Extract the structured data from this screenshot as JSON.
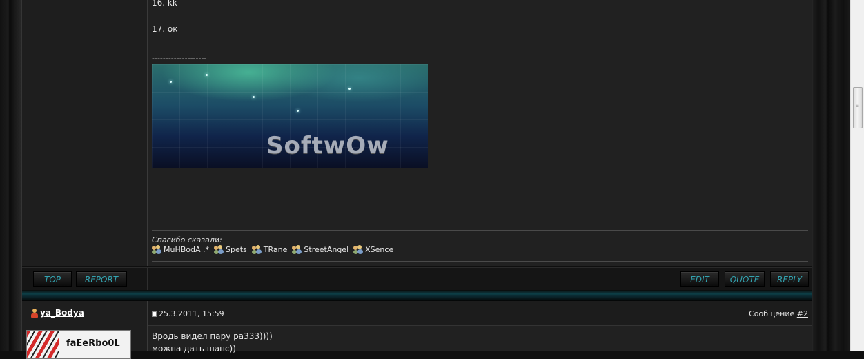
{
  "post1": {
    "lines": [
      "16. kk",
      "17. ок"
    ],
    "signature_sep": "--------------------",
    "banner_text": "SoftwOw",
    "thanks_label": "Спасибо сказали:",
    "thanks_users": [
      "MuHBodA .*",
      "Spets",
      "TRane",
      "StreetAngel",
      "XSence"
    ]
  },
  "buttons": {
    "top": "TOP",
    "report": "REPORT",
    "edit": "EDIT",
    "quote": "QUOTE",
    "reply": "REPLY"
  },
  "post2": {
    "username": "ya_Bodya",
    "date": "25.3.2011, 15:59",
    "message_label": "Сообщение",
    "message_num": "#2",
    "avatar_text": "faEeRbo0L",
    "lines": [
      "Вродь видел пару ра333))))",
      "можна дать шанс))"
    ]
  },
  "colors": {
    "accent": "#33a3b0",
    "background": "#212121"
  }
}
